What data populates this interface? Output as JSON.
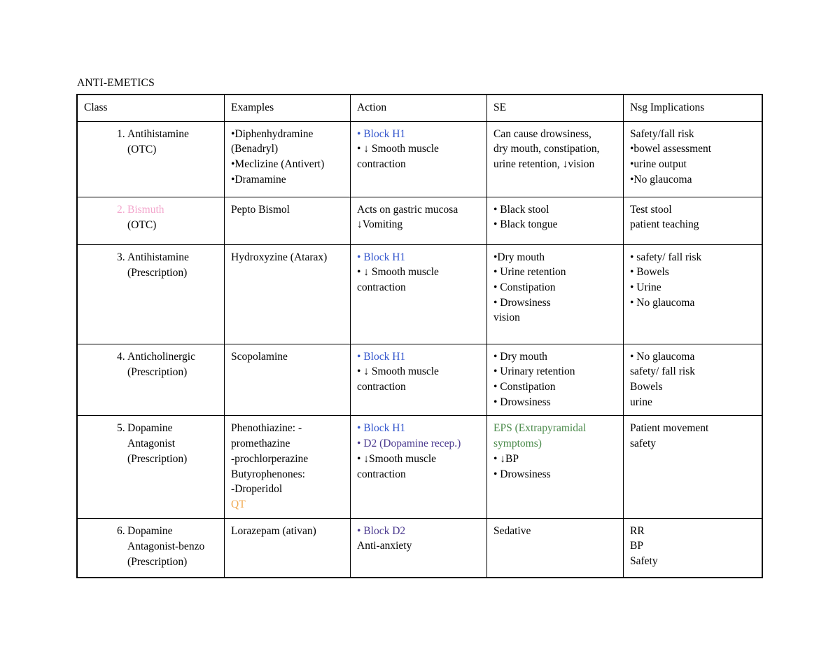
{
  "document": {
    "title": "ANTI-EMETICS"
  },
  "colors": {
    "blue": "#3355cc",
    "purple": "#4b3a8f",
    "green": "#4a8a4a",
    "pink": "#f3a7cd",
    "orange": "#f0a950",
    "black": "#000000",
    "border": "#000000",
    "background": "#ffffff"
  },
  "table": {
    "headers": [
      "Class",
      "Examples",
      "Action",
      "SE",
      "Nsg Implications"
    ],
    "rows": [
      {
        "num": "1.",
        "class_lines": [
          "Antihistamine",
          "(OTC)"
        ],
        "class_color": "black",
        "examples": [
          "•Diphenhydramine",
          "(Benadryl)",
          "•Meclizine (Antivert)",
          "•Dramamine"
        ],
        "action": [
          "• Block H1",
          "• ↓ Smooth muscle",
          "contraction"
        ],
        "action_colors": [
          "blue",
          "black",
          "black"
        ],
        "se": [
          "Can cause drowsiness,",
          "dry mouth, constipation,",
          "urine retention, ↓vision"
        ],
        "nsg": [
          "Safety/fall risk",
          "•bowel assessment",
          "•urine output",
          "•No glaucoma"
        ]
      },
      {
        "num": "2.",
        "class_lines": [
          "Bismuth",
          "(OTC)"
        ],
        "class_color": "pink",
        "examples": [
          "Pepto Bismol"
        ],
        "action": [
          "Acts on gastric mucosa",
          "↓Vomiting"
        ],
        "action_colors": [
          "black",
          "black"
        ],
        "se": [
          "• Black stool",
          "• Black tongue"
        ],
        "nsg": [
          "Test stool",
          "patient teaching"
        ]
      },
      {
        "num": "3.",
        "class_lines": [
          "Antihistamine",
          "(Prescription)"
        ],
        "class_color": "black",
        "examples": [
          "Hydroxyzine (Atarax)"
        ],
        "action": [
          "• Block H1",
          "• ↓ Smooth muscle",
          "contraction"
        ],
        "action_colors": [
          "blue",
          "black",
          "black"
        ],
        "se": [
          "•Dry mouth",
          "• Urine retention",
          "• Constipation",
          "• Drowsiness",
          "vision"
        ],
        "nsg": [
          "• safety/ fall risk",
          "• Bowels",
          "• Urine",
          "• No glaucoma"
        ]
      },
      {
        "num": "4.",
        "class_lines": [
          "Anticholinergic",
          "(Prescription)"
        ],
        "class_color": "black",
        "examples": [
          "Scopolamine"
        ],
        "action": [
          "• Block H1",
          "• ↓ Smooth muscle",
          "contraction"
        ],
        "action_colors": [
          "blue",
          "black",
          "black"
        ],
        "se": [
          "• Dry mouth",
          "• Urinary retention",
          "• Constipation",
          "• Drowsiness"
        ],
        "nsg": [
          "• No glaucoma",
          "safety/ fall risk",
          "Bowels",
          "urine"
        ]
      },
      {
        "num": "5.",
        "class_lines": [
          "Dopamine",
          "Antagonist",
          "(Prescription)"
        ],
        "class_color": "black",
        "examples": [
          "Phenothiazine: -",
          "promethazine",
          "-prochlorperazine",
          "Butyrophenones:",
          "-Droperidol",
          "QT"
        ],
        "examples_colors": [
          "black",
          "black",
          "black",
          "black",
          "black",
          "orange"
        ],
        "action": [
          "• Block H1",
          "• D2 (Dopamine recep.)",
          "• ↓Smooth muscle",
          "contraction"
        ],
        "action_colors": [
          "blue",
          "purple",
          "black",
          "black"
        ],
        "se": [
          "EPS (Extrapyramidal",
          "symptoms)",
          "• ↓BP",
          "• Drowsiness"
        ],
        "se_colors": [
          "green",
          "green",
          "black",
          "black"
        ],
        "nsg": [
          "Patient movement",
          "safety"
        ]
      },
      {
        "num": "6.",
        "class_lines": [
          "Dopamine",
          "Antagonist-benzo",
          "(Prescription)"
        ],
        "class_color": "black",
        "examples": [
          "Lorazepam (ativan)"
        ],
        "action": [
          "• Block D2",
          "Anti-anxiety"
        ],
        "action_colors": [
          "purple",
          "black"
        ],
        "se": [
          "Sedative"
        ],
        "nsg": [
          "RR",
          "BP",
          "Safety"
        ]
      }
    ]
  }
}
